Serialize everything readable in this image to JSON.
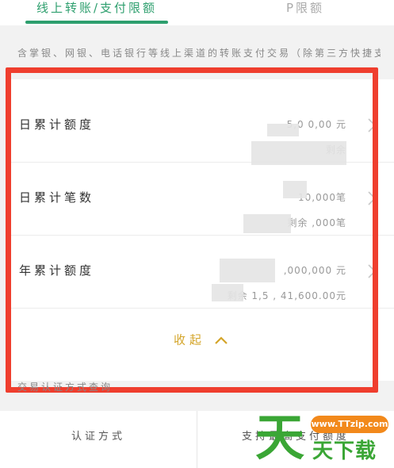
{
  "tabs": [
    {
      "label": "线上转账/支付限额",
      "active": true
    },
    {
      "label": "P限额",
      "active": false
    }
  ],
  "notice": "含掌银、网银、电话银行等线上渠道的转账支付交易（除第三方快捷支付）",
  "limits": [
    {
      "label": "日累计额度",
      "value": "5,0 0,00 元",
      "remaining": "剩余"
    },
    {
      "label": "日累计笔数",
      "value": "10,000笔",
      "remaining": "剩余 ,000笔"
    },
    {
      "label": "年累计额度",
      "value": "  ,000,000 元",
      "remaining": "剩余  1,5 , 41,600.00元"
    }
  ],
  "collapse_label": "收起",
  "section_title": "交易认证方式查询",
  "bottom": {
    "left": "认证方式",
    "right": "支持最高支付额度"
  },
  "watermark": {
    "url": "www.TTzip.com",
    "big": "天",
    "small": "天下载"
  },
  "colors": {
    "accent": "#2e9f6e",
    "highlight": "#ef3e2e",
    "collapse": "#d4a52a",
    "watermark": "#3aa635"
  }
}
